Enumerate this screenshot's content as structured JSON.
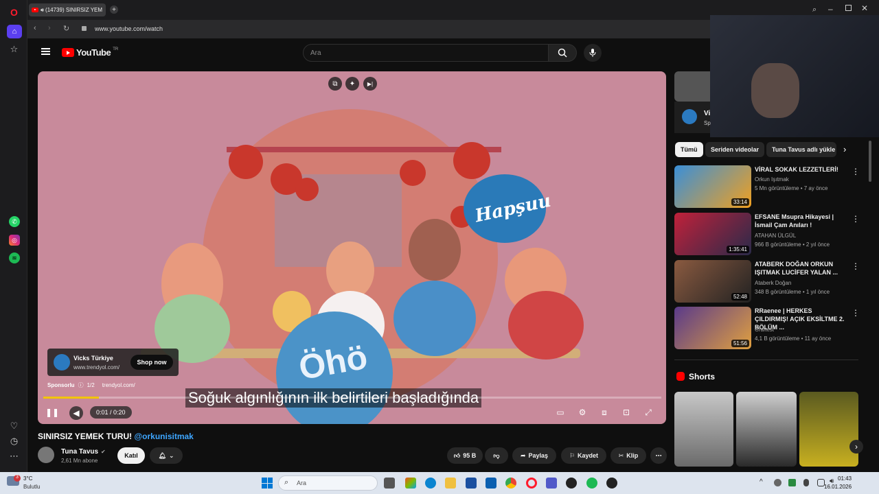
{
  "browser": {
    "tab_title": "(14739) SINIRSIZ YEM",
    "url": "www.youtube.com/watch"
  },
  "youtube": {
    "logo_text": "YouTube",
    "logo_region": "TR",
    "search_placeholder": "Ara"
  },
  "player": {
    "subtitle": "Soğuk algınlığının ilk belirtileri başladığında",
    "ad": {
      "brand": "Vicks Türkiye",
      "url": "www.trendyol.com/",
      "cta": "Shop now",
      "sponsored_label": "Sponsorlu",
      "ad_count": "1/2",
      "domain": "trendyol.com/"
    },
    "time": "0:01 / 0:20",
    "progress_fraction": 0.09,
    "art_text_1": "Hapşuu",
    "art_text_2": "Öhö"
  },
  "video": {
    "title": "SINIRSIZ YEMEK TURU!",
    "title_handle": "@orkunisitmak",
    "channel": "Tuna Tavus",
    "subscribers": "2,61 Mn abone",
    "join_label": "Katıl",
    "likes": "95 B",
    "share_label": "Paylaş",
    "save_label": "Kaydet",
    "clip_label": "Klip"
  },
  "sidebar_top_card": {
    "title": "Vi",
    "sub": "Sp"
  },
  "chips": [
    "Tümü",
    "Seriden videolar",
    "Tuna Tavus adlı yükle"
  ],
  "recommendations": [
    {
      "title": "VİRAL SOKAK LEZZETLERİ!",
      "channel": "Orkun Işıtmak",
      "meta": "5 Mn görüntüleme • 7 ay önce",
      "duration": "33:14"
    },
    {
      "title": "EFSANE Msupra Hikayesi | İsmail Çam Anıları !",
      "channel": "ATAHAN ÜLGÜL",
      "meta": "966 B görüntüleme • 2 yıl önce",
      "duration": "1:35:41"
    },
    {
      "title": "ATABERK DOĞAN ORKUN IŞITMAK LUCİFER YALAN ...",
      "channel": "Ataberk Doğan",
      "meta": "348 B görüntüleme • 1 yıl önce",
      "duration": "52:48"
    },
    {
      "title": "RRaenee | HERKES ÇILDIRMIŞ! AÇIK EKSİLTME 2. BÖLÜM ...",
      "channel": "Craftest",
      "meta": "4,1 B görüntüleme • 11 ay önce",
      "duration": "51:56"
    }
  ],
  "shorts_label": "Shorts",
  "taskbar": {
    "weather_temp": "3°C",
    "weather_desc": "Bulutlu",
    "weather_badge": "3",
    "search_placeholder": "Ara",
    "time": "01:43",
    "date": "16.01.2026"
  },
  "colors": {
    "yt_red": "#ff0000",
    "progress_yellow": "#f2c500",
    "link_blue": "#3ea6ff"
  }
}
